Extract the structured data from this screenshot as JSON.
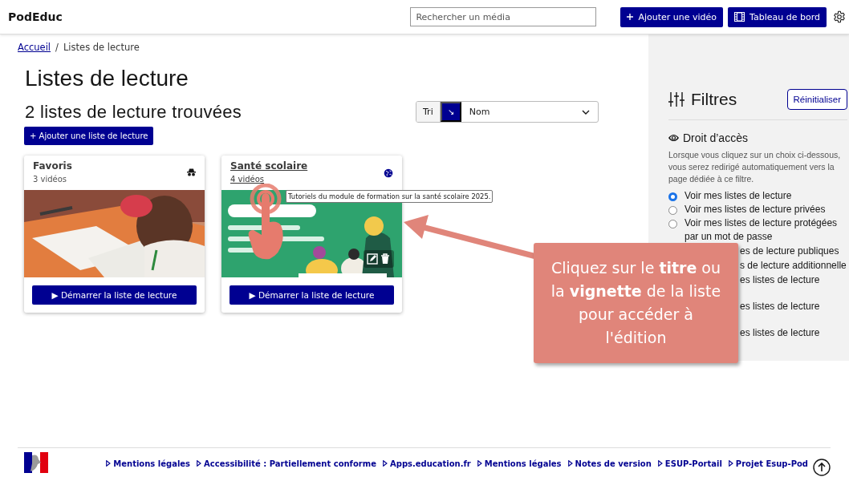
{
  "header": {
    "logo": "PodEduc",
    "search": {
      "placeholder": "Rechercher un média"
    },
    "buttons": [
      {
        "label": "Ajouter une vidéo"
      },
      {
        "label": "Tableau de bord"
      }
    ]
  },
  "breadcrumb": [
    {
      "label": "Accueil",
      "link": true
    },
    {
      "label": "Listes de lecture",
      "link": false
    }
  ],
  "breadcrumb_separator": "/",
  "page_title": "Listes de lecture",
  "result_count": "2 listes de lecture trouvées",
  "sort": {
    "label": "Tri",
    "direction": "↘",
    "value": "Nom"
  },
  "add_button": "+ Ajouter une liste de lecture",
  "playlists": [
    {
      "title": "Favoris",
      "count": "3 vidéos",
      "linked": false,
      "editable": false,
      "button": "▶ Démarrer la liste de lecture"
    },
    {
      "title": "Santé scolaire",
      "count": "4 vidéos",
      "linked": true,
      "editable": true,
      "button": "▶ Démarrer la liste de lecture"
    }
  ],
  "tooltip": "Tutoriels du module de formation sur la santé scolaire 2025.",
  "filters": {
    "title": "Filtres",
    "reset": "Réinitialiser",
    "section": "Droit d’accès",
    "description": "Lorsque vous cliquez sur un choix ci-dessous, vous serez redirigé automatiquement vers la page dédiée à ce filtre.",
    "options": [
      {
        "label": "Voir mes listes de lecture",
        "selected": true
      },
      {
        "label": "Voir mes listes de lecture privées",
        "selected": false
      },
      {
        "label": "Voir mes listes de lecture protégées par un mot de passe",
        "selected": false
      }
    ],
    "covered_labels": [
      "es de lecture publiques",
      "s de lecture additionnelle",
      "es listes de lecture",
      "es listes de lecture",
      "es listes de lecture"
    ]
  },
  "callout": {
    "text": "Cliquez sur le **titre** ou la **vignette** de la liste pour accéder à l'édition"
  },
  "footer": {
    "links": [
      "Mentions légales",
      "Accessibilité : Partiellement conforme",
      "Apps.education.fr",
      "Mentions légales",
      "Notes de version",
      "ESUP-Portail",
      "Projet Esup-Pod"
    ]
  }
}
